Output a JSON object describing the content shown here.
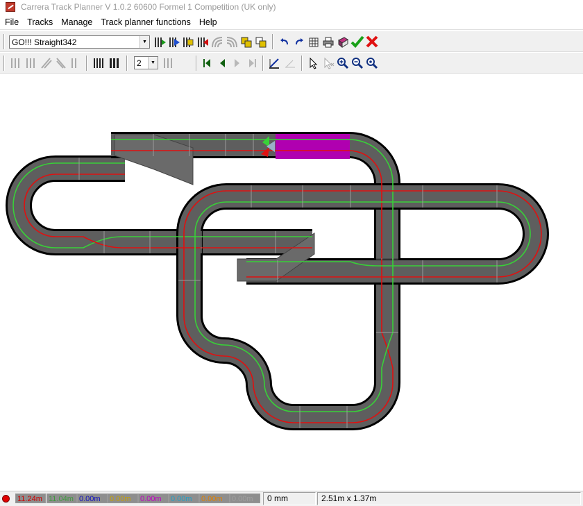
{
  "window": {
    "title": "Carrera Track Planner V 1.0.2 60600 Formel 1 Competition (UK only)"
  },
  "menu": {
    "items": [
      "File",
      "Tracks",
      "Manage",
      "Track planner functions",
      "Help"
    ]
  },
  "toolbar": {
    "track_select": {
      "value": "GO!!! Straight342"
    },
    "lanes_select": {
      "value": "2"
    }
  },
  "status": {
    "lengths": [
      {
        "value": "11.24m",
        "text_color": "#d00000",
        "bg": "#8e8e8e"
      },
      {
        "value": "11.04m",
        "text_color": "#3f9b3f",
        "bg": "#8e8e8e"
      },
      {
        "value": "0.00m",
        "text_color": "#1010c0",
        "bg": "#8e8e8e"
      },
      {
        "value": "0.00m",
        "text_color": "#c8a000",
        "bg": "#8e8e8e"
      },
      {
        "value": "0.00m",
        "text_color": "#c000c0",
        "bg": "#8e8e8e"
      },
      {
        "value": "0.00m",
        "text_color": "#20a0c8",
        "bg": "#8e8e8e"
      },
      {
        "value": "0.00m",
        "text_color": "#e08000",
        "bg": "#8e8e8e"
      },
      {
        "value": "0.00m",
        "text_color": "#a0a0a0",
        "bg": "#8e8e8e"
      }
    ],
    "position_readout": "0 mm",
    "track_size": "2.51m x 1.37m"
  },
  "colors": {
    "track_surface": "#5e5e5e",
    "lane_red": "#e01010",
    "lane_green": "#38d038",
    "start_section": "#b000b0",
    "outline": "#000000"
  }
}
